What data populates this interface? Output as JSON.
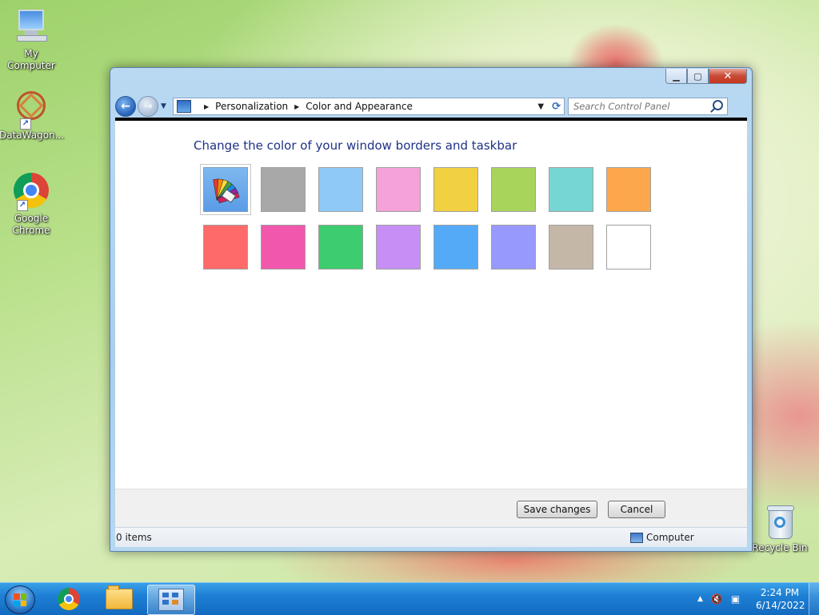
{
  "desktop": {
    "icons": [
      {
        "label": "My Computer",
        "icon": "my-computer-icon"
      },
      {
        "label": "DataWagon...",
        "icon": "datawagon-icon"
      },
      {
        "label": "Google Chrome",
        "icon": "chrome-icon"
      },
      {
        "label": "Recycle Bin",
        "icon": "recycle-bin-icon"
      }
    ]
  },
  "window": {
    "caption": {
      "minimize": "▁",
      "maximize": "▢",
      "close": "✕"
    },
    "breadcrumb": [
      "Personalization",
      "Color and Appearance"
    ],
    "search_placeholder": "Search Control Panel",
    "heading": "Change the color of your window borders and taskbar",
    "swatches_row1": [
      "custom",
      "#a8a8a8",
      "#8ec9f8",
      "#f4a2d8",
      "#f1d041",
      "#a9d45c",
      "#76d6d4",
      "#fda74d"
    ],
    "swatches_row2": [
      "#fe6a6a",
      "#f157ac",
      "#3dcc6e",
      "#c78ff5",
      "#55aaf8",
      "#9899fc",
      "#c5b7a8",
      "#ffffff"
    ],
    "buttons": {
      "save": "Save changes",
      "cancel": "Cancel"
    },
    "status": {
      "items": "0 items",
      "location": "Computer"
    }
  },
  "taskbar": {
    "clock_time": "2:24 PM",
    "clock_date": "6/14/2022"
  }
}
